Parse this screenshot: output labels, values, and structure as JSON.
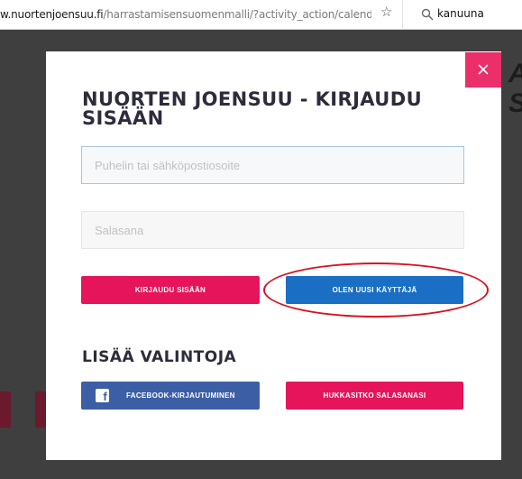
{
  "browser": {
    "url_host": "w.nuortenjoensuu.fi",
    "url_path": "/harrastamisensuomenmalli/?activity_action/calendarvie",
    "bookmark_icon": "star-icon",
    "search_icon": "search-icon",
    "search_text": "kanuuna"
  },
  "background": {
    "heading_text": "AR SU"
  },
  "modal": {
    "close_icon": "close-icon",
    "title": "NUORTEN JOENSUU - KIRJAUDU SISÄÄN",
    "phone_placeholder": "Puhelin tai sähköpostiosoite",
    "phone_value": "",
    "password_placeholder": "Salasana",
    "password_value": "",
    "login_label": "KIRJAUDU SISÄÄN",
    "register_label": "OLEN UUSI KÄYTTÄJÄ",
    "more_options_title": "LISÄÄ VALINTOJA",
    "facebook_icon_glyph": "f",
    "facebook_label": "FACEBOOK-KIRJAUTUMINEN",
    "forgot_label": "HUKKASITKO SALASANASI"
  },
  "colors": {
    "accent_pink": "#e6145a",
    "close_pink": "#ea2f6a",
    "register_blue": "#1a6fc4",
    "facebook_blue": "#3c5ea5",
    "annotation_red": "#d8101f",
    "overlay": "#3f3f3f"
  }
}
